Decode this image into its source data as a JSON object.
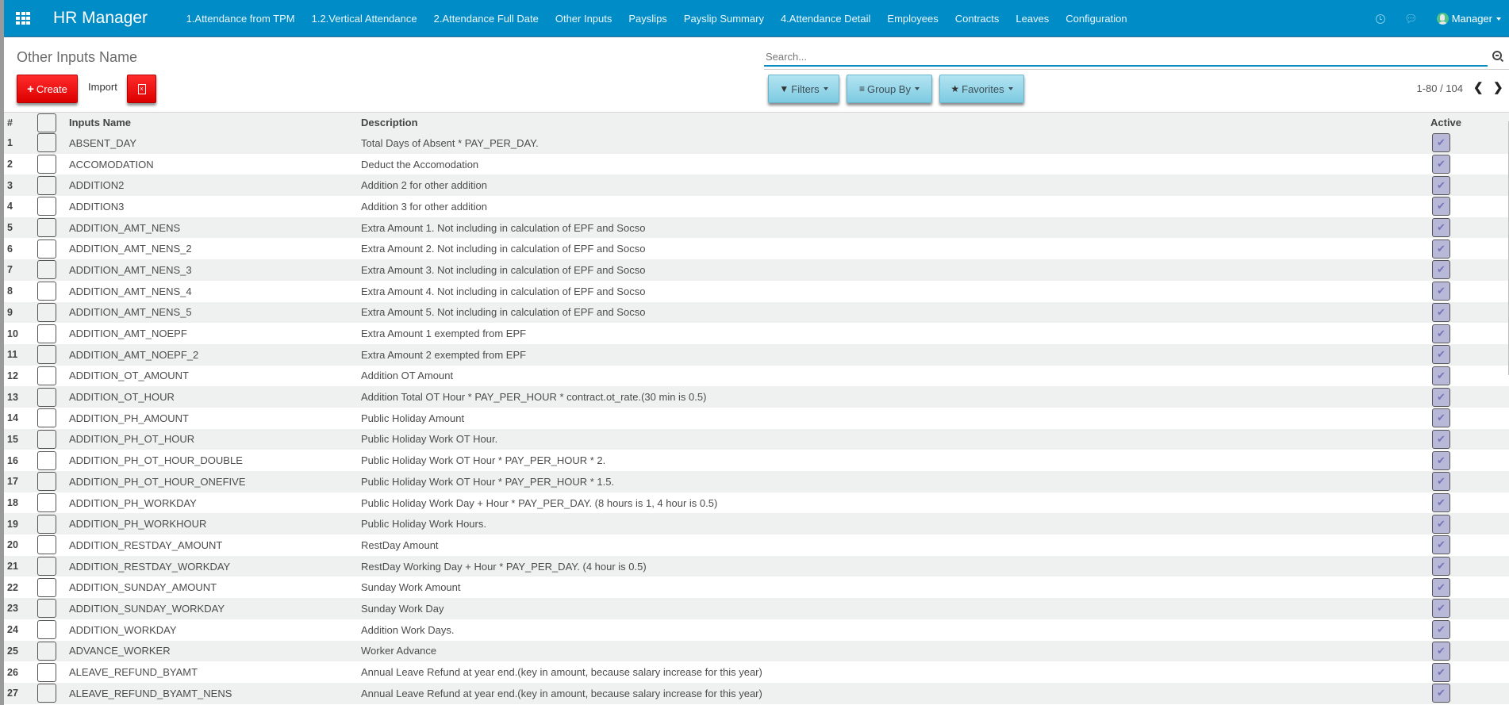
{
  "app": {
    "brand": "HR Manager",
    "accent_color": "#008dc7",
    "nav": [
      "1.Attendance from TPM",
      "1.2.Vertical Attendance",
      "2.Attendance Full Date",
      "Other Inputs",
      "Payslips",
      "Payslip Summary",
      "4.Attendance Detail",
      "Employees",
      "Contracts",
      "Leaves",
      "Configuration"
    ],
    "user": "Manager",
    "icons": {
      "apps": "grid-icon",
      "activity": "clock-icon",
      "messages": "chat-icon"
    }
  },
  "control": {
    "title": "Other Inputs Name",
    "create_label": "Create",
    "import_label": "Import",
    "export_icon": "excel-icon",
    "search_placeholder": "Search...",
    "search_value": "",
    "filters_label": "Filters",
    "groupby_label": "Group By",
    "favorites_label": "Favorites",
    "pager": "1-80 / 104"
  },
  "table": {
    "columns": {
      "num": "#",
      "name": "Inputs Name",
      "desc": "Description",
      "active": "Active"
    },
    "rows": [
      {
        "num": "1",
        "name": "ABSENT_DAY",
        "desc": "Total Days of Absent * PAY_PER_DAY.",
        "active": true
      },
      {
        "num": "2",
        "name": "ACCOMODATION",
        "desc": "Deduct the Accomodation",
        "active": true
      },
      {
        "num": "3",
        "name": "ADDITION2",
        "desc": "Addition 2 for other addition",
        "active": true
      },
      {
        "num": "4",
        "name": "ADDITION3",
        "desc": "Addition 3 for other addition",
        "active": true
      },
      {
        "num": "5",
        "name": "ADDITION_AMT_NENS",
        "desc": "Extra Amount 1. Not including in calculation of EPF and Socso",
        "active": true
      },
      {
        "num": "6",
        "name": "ADDITION_AMT_NENS_2",
        "desc": "Extra Amount 2. Not including in calculation of EPF and Socso",
        "active": true
      },
      {
        "num": "7",
        "name": "ADDITION_AMT_NENS_3",
        "desc": "Extra Amount 3. Not including in calculation of EPF and Socso",
        "active": true
      },
      {
        "num": "8",
        "name": "ADDITION_AMT_NENS_4",
        "desc": "Extra Amount 4. Not including in calculation of EPF and Socso",
        "active": true
      },
      {
        "num": "9",
        "name": "ADDITION_AMT_NENS_5",
        "desc": "Extra Amount 5. Not including in calculation of EPF and Socso",
        "active": true
      },
      {
        "num": "10",
        "name": "ADDITION_AMT_NOEPF",
        "desc": "Extra Amount 1 exempted from EPF",
        "active": true
      },
      {
        "num": "11",
        "name": "ADDITION_AMT_NOEPF_2",
        "desc": "Extra Amount 2 exempted from EPF",
        "active": true
      },
      {
        "num": "12",
        "name": "ADDITION_OT_AMOUNT",
        "desc": "Addition OT Amount",
        "active": true
      },
      {
        "num": "13",
        "name": "ADDITION_OT_HOUR",
        "desc": "Addition Total OT Hour * PAY_PER_HOUR * contract.ot_rate.(30 min is 0.5)",
        "active": true
      },
      {
        "num": "14",
        "name": "ADDITION_PH_AMOUNT",
        "desc": "Public Holiday Amount",
        "active": true
      },
      {
        "num": "15",
        "name": "ADDITION_PH_OT_HOUR",
        "desc": "Public Holiday Work OT Hour.",
        "active": true
      },
      {
        "num": "16",
        "name": "ADDITION_PH_OT_HOUR_DOUBLE",
        "desc": "Public Holiday Work OT Hour * PAY_PER_HOUR * 2.",
        "active": true
      },
      {
        "num": "17",
        "name": "ADDITION_PH_OT_HOUR_ONEFIVE",
        "desc": "Public Holiday Work OT Hour * PAY_PER_HOUR * 1.5.",
        "active": true
      },
      {
        "num": "18",
        "name": "ADDITION_PH_WORKDAY",
        "desc": "Public Holiday Work Day + Hour * PAY_PER_DAY. (8 hours is 1, 4 hour is 0.5)",
        "active": true
      },
      {
        "num": "19",
        "name": "ADDITION_PH_WORKHOUR",
        "desc": "Public Holiday Work Hours.",
        "active": true
      },
      {
        "num": "20",
        "name": "ADDITION_RESTDAY_AMOUNT",
        "desc": "RestDay Amount",
        "active": true
      },
      {
        "num": "21",
        "name": "ADDITION_RESTDAY_WORKDAY",
        "desc": "RestDay Working Day + Hour * PAY_PER_DAY. (4 hour is 0.5)",
        "active": true
      },
      {
        "num": "22",
        "name": "ADDITION_SUNDAY_AMOUNT",
        "desc": "Sunday Work Amount",
        "active": true
      },
      {
        "num": "23",
        "name": "ADDITION_SUNDAY_WORKDAY",
        "desc": "Sunday Work Day",
        "active": true
      },
      {
        "num": "24",
        "name": "ADDITION_WORKDAY",
        "desc": "Addition Work Days.",
        "active": true
      },
      {
        "num": "25",
        "name": "ADVANCE_WORKER",
        "desc": "Worker Advance",
        "active": true
      },
      {
        "num": "26",
        "name": "ALEAVE_REFUND_BYAMT",
        "desc": "Annual Leave Refund at year end.(key in amount, because salary increase for this year)",
        "active": true
      },
      {
        "num": "27",
        "name": "ALEAVE_REFUND_BYAMT_NENS",
        "desc": "Annual Leave Refund at year end.(key in amount, because salary increase for this year)",
        "active": true
      }
    ]
  }
}
